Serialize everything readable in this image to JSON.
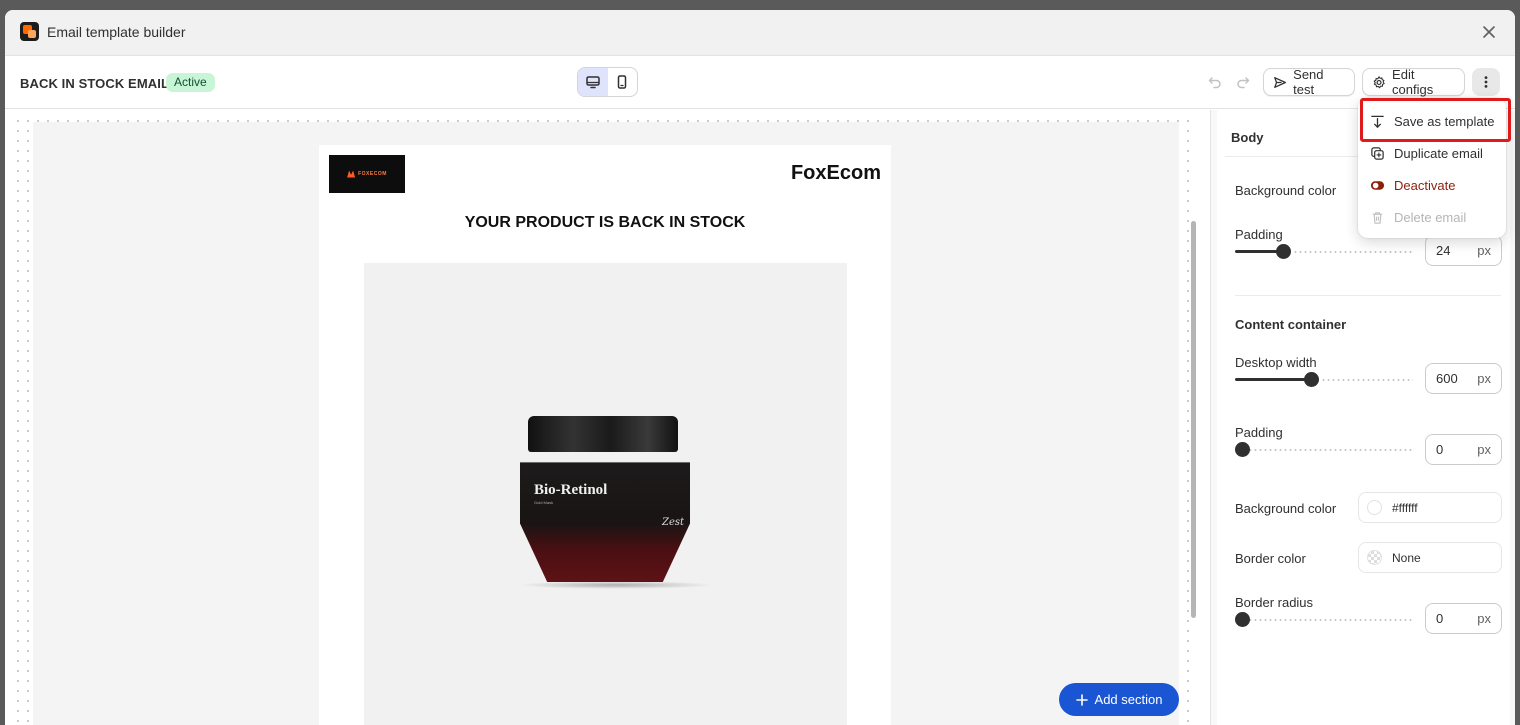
{
  "window": {
    "title": "Email template builder"
  },
  "toolbar": {
    "email_name": "BACK IN STOCK EMAIL",
    "status": "Active",
    "send_test_label": "Send test",
    "edit_configs_label": "Edit configs"
  },
  "email_preview": {
    "brand_logo_text": "FOXECOM",
    "brand_name": "FoxEcom",
    "headline": "YOUR PRODUCT IS BACK IN STOCK",
    "product_label": "Bio-Retinol",
    "product_sub": "Gold Mask",
    "product_brand": "Zest"
  },
  "canvas": {
    "add_section_label": "Add section"
  },
  "panel": {
    "body_title": "Body",
    "background_color_label": "Background color",
    "padding_label": "Padding",
    "padding_value": "24",
    "padding_slider": 0.24,
    "unit": "px",
    "content_container_title": "Content container",
    "desktop_width_label": "Desktop width",
    "desktop_width_value": "600",
    "desktop_width_slider": 0.4,
    "container_padding_label": "Padding",
    "container_padding_value": "0",
    "container_background_label": "Background color",
    "container_background_value": "#ffffff",
    "border_color_label": "Border color",
    "border_color_value": "None",
    "border_radius_label": "Border radius",
    "border_radius_value": "0"
  },
  "menu": {
    "items": [
      {
        "label": "Save as template",
        "icon": "save-template-icon"
      },
      {
        "label": "Duplicate email",
        "icon": "duplicate-icon"
      },
      {
        "label": "Deactivate",
        "icon": "toggle-icon"
      },
      {
        "label": "Delete email",
        "icon": "trash-icon"
      }
    ]
  },
  "colors": {
    "accent": "#1a55d4",
    "active_badge_bg": "#c7f5d5",
    "danger": "#8e1f0b",
    "highlight": "#e0191b"
  }
}
